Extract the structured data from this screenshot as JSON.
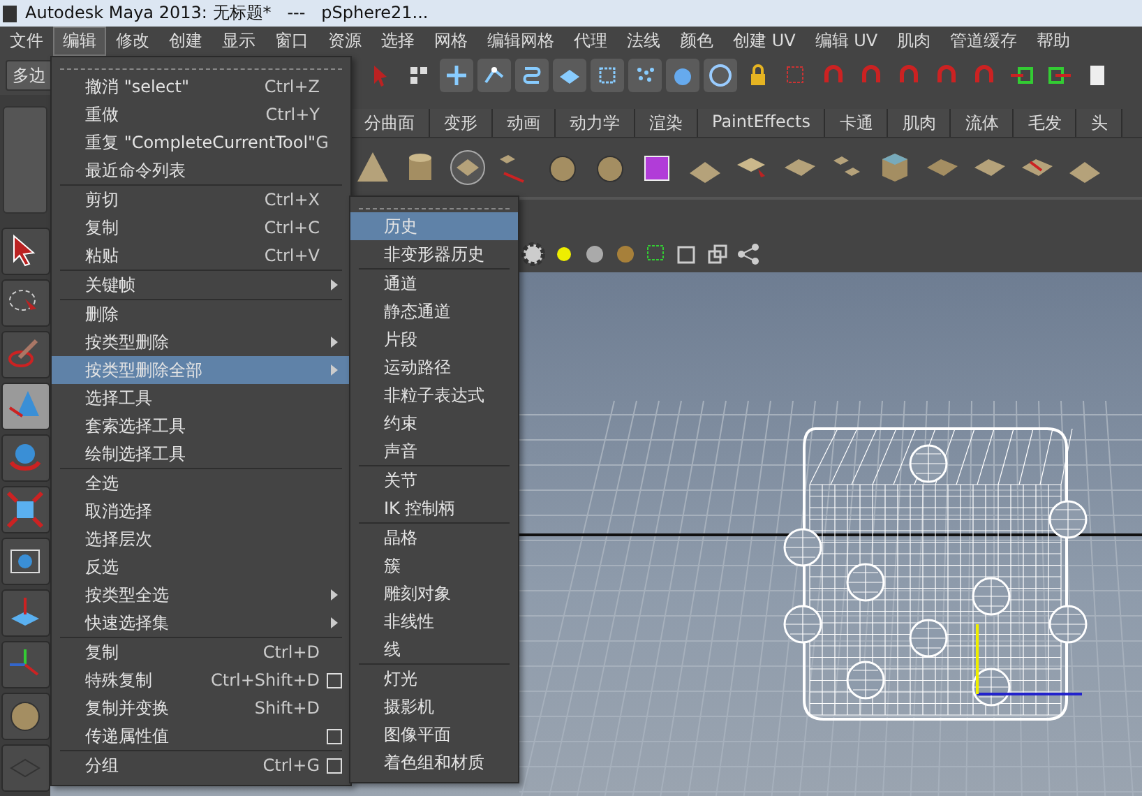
{
  "window": {
    "title": "Autodesk Maya 2013: 无标题*   ---   pSphere21..."
  },
  "menubar": [
    {
      "label": "文件",
      "selected": false
    },
    {
      "label": "编辑",
      "selected": true
    },
    {
      "label": "修改",
      "selected": false
    },
    {
      "label": "创建",
      "selected": false
    },
    {
      "label": "显示",
      "selected": false
    },
    {
      "label": "窗口",
      "selected": false
    },
    {
      "label": "资源",
      "selected": false
    },
    {
      "label": "选择",
      "selected": false
    },
    {
      "label": "网格",
      "selected": false
    },
    {
      "label": "编辑网格",
      "selected": false
    },
    {
      "label": "代理",
      "selected": false
    },
    {
      "label": "法线",
      "selected": false
    },
    {
      "label": "颜色",
      "selected": false
    },
    {
      "label": "创建 UV",
      "selected": false
    },
    {
      "label": "编辑 UV",
      "selected": false
    },
    {
      "label": "肌肉",
      "selected": false
    },
    {
      "label": "管道缓存",
      "selected": false
    },
    {
      "label": "帮助",
      "selected": false
    }
  ],
  "mode_dropdown": {
    "value": "多边"
  },
  "shelf_tabs": [
    {
      "label": "分曲面",
      "selected": false
    },
    {
      "label": "变形",
      "selected": false
    },
    {
      "label": "动画",
      "selected": false
    },
    {
      "label": "动力学",
      "selected": false
    },
    {
      "label": "渲染",
      "selected": false
    },
    {
      "label": "PaintEffects",
      "selected": false
    },
    {
      "label": "卡通",
      "selected": false
    },
    {
      "label": "肌肉",
      "selected": false
    },
    {
      "label": "流体",
      "selected": false
    },
    {
      "label": "毛发",
      "selected": false
    },
    {
      "label": "头",
      "selected": false
    }
  ],
  "tools": [
    {
      "selected": false
    },
    {
      "selected": false
    },
    {
      "selected": false
    },
    {
      "selected": true
    },
    {
      "selected": false
    },
    {
      "selected": false
    },
    {
      "selected": false
    },
    {
      "selected": false
    },
    {
      "selected": false
    },
    {
      "selected": false
    },
    {
      "selected": false
    }
  ],
  "edit_menu": [
    {
      "kind": "tearoff"
    },
    {
      "kind": "item",
      "label": "撤消 \"select\"",
      "shortcut": "Ctrl+Z",
      "selected": false
    },
    {
      "kind": "item",
      "label": "重做",
      "shortcut": "Ctrl+Y",
      "selected": false
    },
    {
      "kind": "item",
      "label": "重复 \"CompleteCurrentTool\"",
      "shortcut": "G",
      "selected": false
    },
    {
      "kind": "item",
      "label": "最近命令列表",
      "selected": false
    },
    {
      "kind": "separator"
    },
    {
      "kind": "item",
      "label": "剪切",
      "shortcut": "Ctrl+X",
      "selected": false
    },
    {
      "kind": "item",
      "label": "复制",
      "shortcut": "Ctrl+C",
      "selected": false
    },
    {
      "kind": "item",
      "label": "粘贴",
      "shortcut": "Ctrl+V",
      "selected": false
    },
    {
      "kind": "separator"
    },
    {
      "kind": "item",
      "label": "关键帧",
      "submenu": true,
      "selected": false
    },
    {
      "kind": "separator"
    },
    {
      "kind": "item",
      "label": "删除",
      "selected": false
    },
    {
      "kind": "item",
      "label": "按类型删除",
      "submenu": true,
      "selected": false
    },
    {
      "kind": "item",
      "label": "按类型删除全部",
      "submenu": true,
      "selected": true
    },
    {
      "kind": "item",
      "label": "选择工具",
      "selected": false
    },
    {
      "kind": "item",
      "label": "套索选择工具",
      "selected": false
    },
    {
      "kind": "item",
      "label": "绘制选择工具",
      "selected": false
    },
    {
      "kind": "separator"
    },
    {
      "kind": "item",
      "label": "全选",
      "selected": false
    },
    {
      "kind": "item",
      "label": "取消选择",
      "selected": false
    },
    {
      "kind": "item",
      "label": "选择层次",
      "selected": false
    },
    {
      "kind": "item",
      "label": "反选",
      "selected": false
    },
    {
      "kind": "item",
      "label": "按类型全选",
      "submenu": true,
      "selected": false
    },
    {
      "kind": "item",
      "label": "快速选择集",
      "submenu": true,
      "selected": false
    },
    {
      "kind": "separator"
    },
    {
      "kind": "item",
      "label": "复制",
      "shortcut": "Ctrl+D",
      "selected": false
    },
    {
      "kind": "item",
      "label": "特殊复制",
      "shortcut": "Ctrl+Shift+D",
      "options": true,
      "selected": false
    },
    {
      "kind": "item",
      "label": "复制并变换",
      "shortcut": "Shift+D",
      "selected": false
    },
    {
      "kind": "item",
      "label": "传递属性值",
      "options": true,
      "selected": false
    },
    {
      "kind": "separator"
    },
    {
      "kind": "item",
      "label": "分组",
      "shortcut": "Ctrl+G",
      "options": true,
      "selected": false
    }
  ],
  "submenu": [
    {
      "kind": "tearoff"
    },
    {
      "kind": "item",
      "label": "历史",
      "selected": true
    },
    {
      "kind": "item",
      "label": "非变形器历史",
      "selected": false
    },
    {
      "kind": "separator"
    },
    {
      "kind": "item",
      "label": "通道",
      "selected": false
    },
    {
      "kind": "item",
      "label": "静态通道",
      "selected": false
    },
    {
      "kind": "item",
      "label": "片段",
      "selected": false
    },
    {
      "kind": "item",
      "label": "运动路径",
      "selected": false
    },
    {
      "kind": "item",
      "label": "非粒子表达式",
      "selected": false
    },
    {
      "kind": "item",
      "label": "约束",
      "selected": false
    },
    {
      "kind": "item",
      "label": "声音",
      "selected": false
    },
    {
      "kind": "separator"
    },
    {
      "kind": "item",
      "label": "关节",
      "selected": false
    },
    {
      "kind": "item",
      "label": "IK 控制柄",
      "selected": false
    },
    {
      "kind": "separator"
    },
    {
      "kind": "item",
      "label": "晶格",
      "selected": false
    },
    {
      "kind": "item",
      "label": "簇",
      "selected": false
    },
    {
      "kind": "item",
      "label": "雕刻对象",
      "selected": false
    },
    {
      "kind": "item",
      "label": "非线性",
      "selected": false
    },
    {
      "kind": "item",
      "label": "线",
      "selected": false
    },
    {
      "kind": "separator"
    },
    {
      "kind": "item",
      "label": "灯光",
      "selected": false
    },
    {
      "kind": "item",
      "label": "摄影机",
      "selected": false
    },
    {
      "kind": "item",
      "label": "图像平面",
      "selected": false
    },
    {
      "kind": "item",
      "label": "着色组和材质",
      "selected": false
    }
  ]
}
